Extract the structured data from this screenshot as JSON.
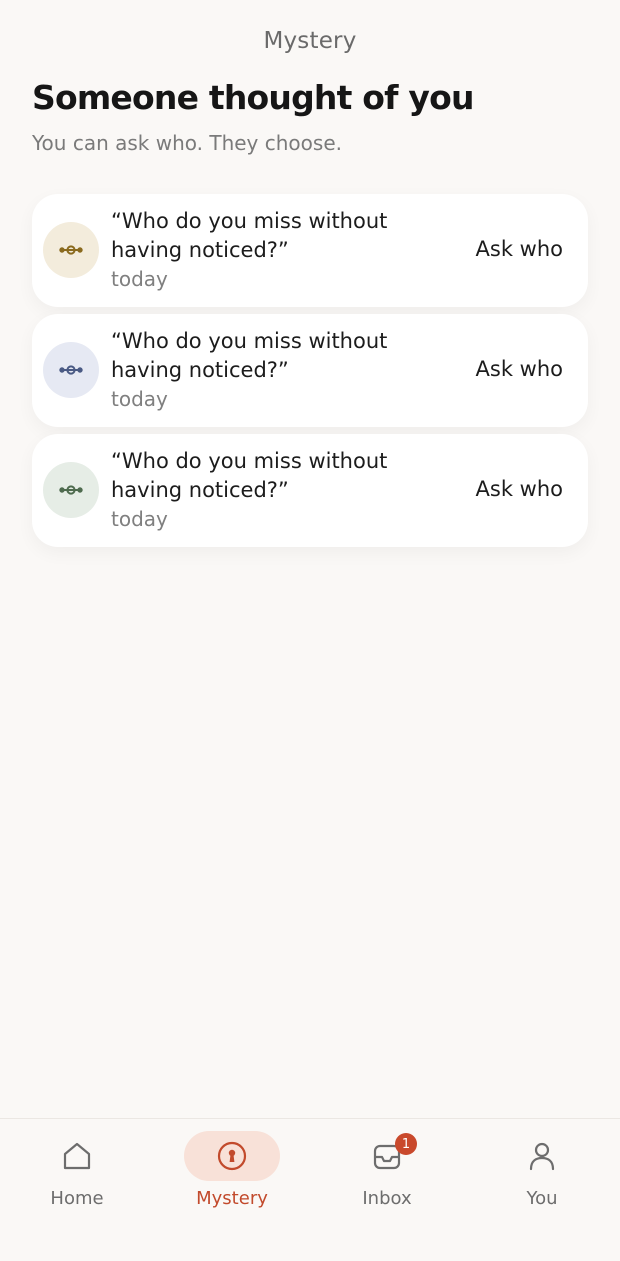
{
  "header": {
    "title": "Mystery",
    "heading": "Someone thought of you",
    "subheading": "You can ask who. They choose."
  },
  "cards": [
    {
      "question": "“Who do you miss without having noticed?”",
      "time": "today",
      "action": "Ask who",
      "avatar_bg": "#f3ecdc",
      "icon_color": "#8a6a1e",
      "icon": "link-icon"
    },
    {
      "question": "“Who do you miss without having noticed?”",
      "time": "today",
      "action": "Ask who",
      "avatar_bg": "#e6e9f3",
      "icon_color": "#4a5a84",
      "icon": "link-icon"
    },
    {
      "question": "“Who do you miss without having noticed?”",
      "time": "today",
      "action": "Ask who",
      "avatar_bg": "#e6ede6",
      "icon_color": "#4e6b4e",
      "icon": "link-icon"
    }
  ],
  "nav": {
    "items": [
      {
        "label": "Home",
        "icon": "home-icon",
        "active": false
      },
      {
        "label": "Mystery",
        "icon": "keyhole-icon",
        "active": true
      },
      {
        "label": "Inbox",
        "icon": "inbox-icon",
        "active": false,
        "badge": "1"
      },
      {
        "label": "You",
        "icon": "person-icon",
        "active": false
      }
    ],
    "accent": "#c24a2c",
    "active_bg": "#f8e1d8"
  }
}
